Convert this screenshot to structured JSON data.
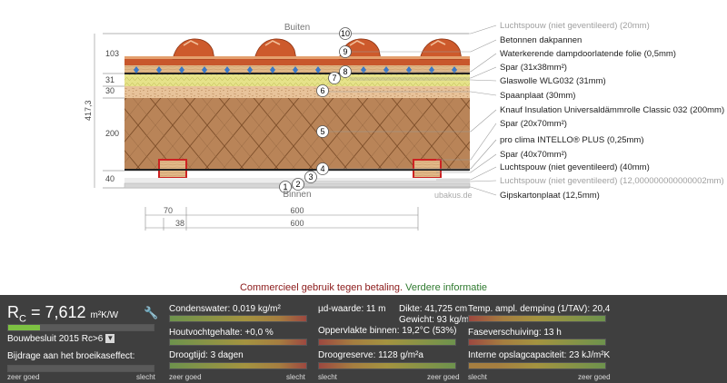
{
  "diagram": {
    "outside_label": "Buiten",
    "inside_label": "Binnen",
    "watermark": "ubakus.de",
    "thickness_labels": [
      "103",
      "31",
      "30",
      "200",
      "40"
    ],
    "total_label": "417,3",
    "dimensions": [
      "70",
      "600",
      "38",
      "600"
    ],
    "layers": [
      {
        "num": "10",
        "label": "Luchtspouw (niet geventileerd) (20mm)",
        "dim": true
      },
      {
        "num": "9",
        "label": "Betonnen dakpannen",
        "dim": false
      },
      {
        "num": "8",
        "label": "Waterkerende dampdoorlatende folie (0,5mm)",
        "dim": false
      },
      {
        "num": "7",
        "label": "Spar (31x38mm²)",
        "dim": false
      },
      {
        "num": "",
        "label": "Glaswolle WLG032 (31mm)",
        "dim": false
      },
      {
        "num": "6",
        "label": "Spaanplaat (30mm)",
        "dim": false
      },
      {
        "num": "5",
        "label": "Knauf Insulation Universaldämmrolle Classic 032 (200mm)",
        "dim": false
      },
      {
        "num": "",
        "label": "Spar (20x70mm²)",
        "dim": false
      },
      {
        "num": "4",
        "label": "pro clima INTELLO® PLUS (0,25mm)",
        "dim": false
      },
      {
        "num": "3",
        "label": "Spar (40x70mm²)",
        "dim": false
      },
      {
        "num": "",
        "label": "Luchtspouw (niet geventileerd) (40mm)",
        "dim": false
      },
      {
        "num": "2",
        "label": "Luchtspouw (niet geventileerd) (12,000000000000002mm)",
        "dim": true
      },
      {
        "num": "1",
        "label": "Gipskartonplaat (12,5mm)",
        "dim": false
      }
    ]
  },
  "notice": {
    "text": "Commercieel gebruik tegen betaling.",
    "link": "Verdere informatie"
  },
  "results": {
    "rc_symbol": "R",
    "rc_sub": "C",
    "rc_value": "= 7,612",
    "rc_unit": "m²K/W",
    "rc_fill": 0.22,
    "standard_select": "Bouwbesluit 2015 Rc>6",
    "greenhouse_label": "Bijdrage aan het broeikaseffect:",
    "scale_good": "zeer goed",
    "scale_bad": "slecht",
    "condensation": "Condenswater: 0,019 kg/m²",
    "wood_moisture": "Houtvochtgehalte: +0,0 %",
    "drying_time": "Droogtijd: 3 dagen",
    "mu_value": "µd-waarde: 11 m",
    "thickness": "Dikte: 41,725 cm",
    "weight": "Gewicht: 93 kg/m²",
    "surface_temp": "Oppervlakte binnen: 19,2°C (53%)",
    "drying_reserve": "Droogreserve: 1128 g/m²a",
    "amplitude_damping": "Temp. ampl. demping (1/TAV): 20,4",
    "phase_shift": "Faseverschuiving: 13 h",
    "heat_capacity": "Interne opslagcapaciteit: 23 kJ/m²K",
    "colors": {
      "green": "#7dc142",
      "yellow": "#e0c22a",
      "orange": "#e39b2a",
      "red": "#d33a2a"
    }
  }
}
